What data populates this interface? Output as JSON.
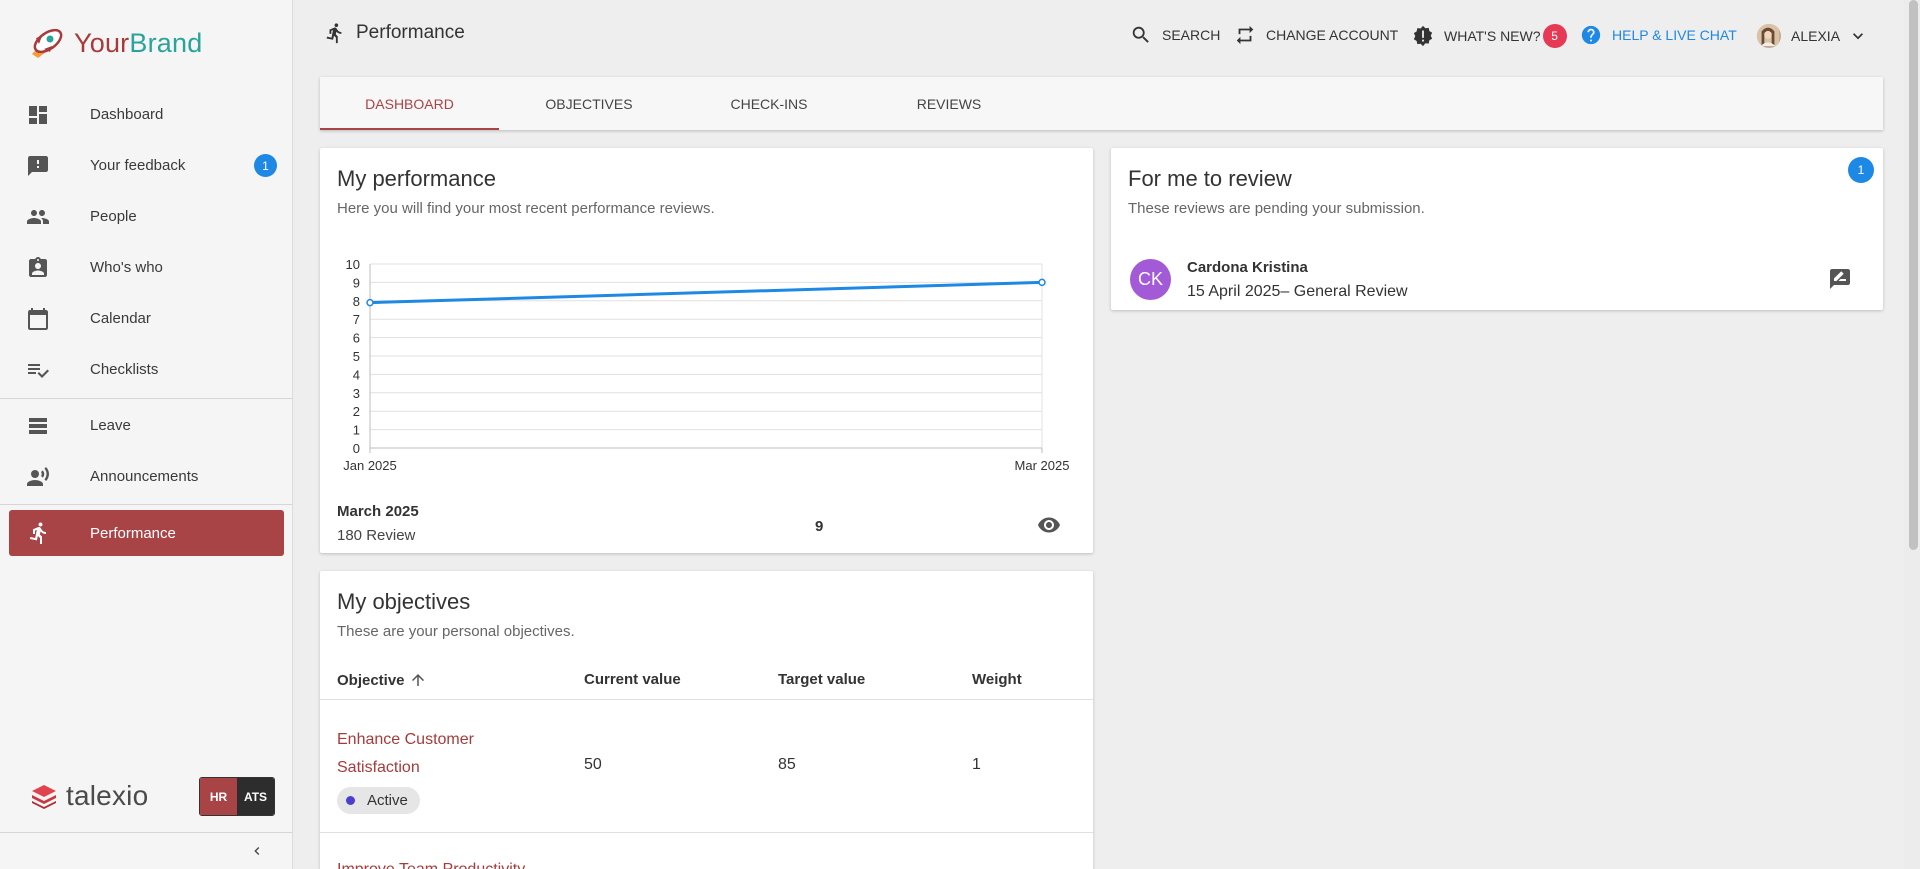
{
  "brand": {
    "name_part1": "Your",
    "name_part2": "Brand",
    "icon": "rocket-logo-icon"
  },
  "sidebar": {
    "items": [
      {
        "label": "Dashboard",
        "icon": "dashboard-icon"
      },
      {
        "label": "Your feedback",
        "icon": "feedback-icon",
        "badge": "1"
      },
      {
        "label": "People",
        "icon": "people-icon"
      },
      {
        "label": "Who's who",
        "icon": "contact-badge-icon"
      },
      {
        "label": "Calendar",
        "icon": "calendar-icon"
      },
      {
        "label": "Checklists",
        "icon": "checklist-icon"
      },
      {
        "label": "Leave",
        "icon": "leave-icon"
      },
      {
        "label": "Announcements",
        "icon": "announcement-icon"
      },
      {
        "label": "Performance",
        "icon": "running-icon",
        "active": true
      }
    ],
    "footer": {
      "logo_text": "talexio",
      "hr": "HR",
      "ats": "ATS"
    }
  },
  "header": {
    "title": "Performance",
    "search": "SEARCH",
    "change_account": "CHANGE ACCOUNT",
    "whats_new": "WHAT'S NEW?",
    "whats_new_count": "5",
    "help": "HELP & LIVE CHAT",
    "user": "ALEXIA"
  },
  "tabs": [
    "DASHBOARD",
    "OBJECTIVES",
    "CHECK-INS",
    "REVIEWS"
  ],
  "my_performance": {
    "title": "My performance",
    "subtitle": "Here you will find your most recent performance reviews.",
    "latest": {
      "date": "March 2025",
      "review": "180 Review",
      "score": "9"
    }
  },
  "for_review": {
    "title": "For me to review",
    "subtitle": "These reviews are pending your submission.",
    "count": "1",
    "item": {
      "initials": "CK",
      "name": "Cardona Kristina",
      "detail": "15 April 2025– General Review"
    }
  },
  "objectives": {
    "title": "My objectives",
    "subtitle": "These are your personal objectives.",
    "columns": [
      "Objective",
      "Current value",
      "Target value",
      "Weight"
    ],
    "rows": [
      {
        "name": "Enhance Customer Satisfaction",
        "current": "50",
        "target": "85",
        "weight": "1",
        "status": "Active"
      }
    ],
    "next_row_partial": "Improve Team Productivity"
  },
  "chart_data": {
    "type": "line",
    "x": [
      "Jan 2025",
      "Mar 2025"
    ],
    "series": [
      {
        "values": [
          7.9,
          9
        ]
      }
    ],
    "ylim": [
      0,
      10
    ],
    "yticks": [
      0,
      1,
      2,
      3,
      4,
      5,
      6,
      7,
      8,
      9,
      10
    ],
    "grid": true,
    "line_color": "#1e88e5"
  }
}
